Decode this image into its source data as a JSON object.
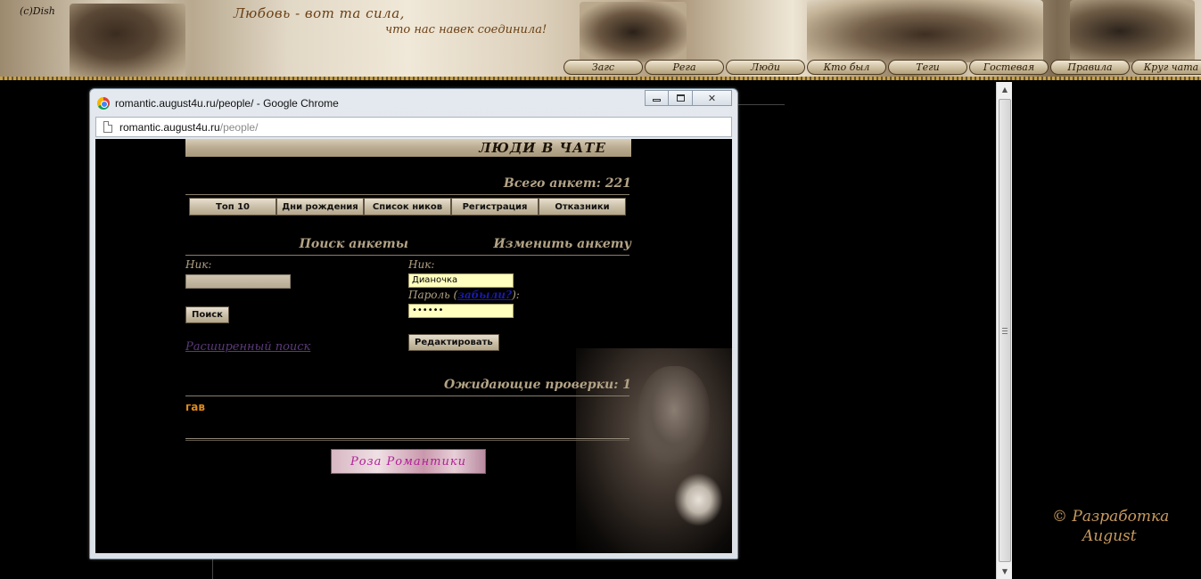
{
  "site": {
    "signature": "(c)Dish",
    "slogan_line1": "Любовь - вот та сила,",
    "slogan_line2": "что нас навек соединила!",
    "nav": [
      "Загс",
      "Рега",
      "Люди",
      "Кто был",
      "Теги",
      "Гостевая",
      "Правила",
      "Круг чата"
    ],
    "credit_line1": "©  Разработка",
    "credit_line2": "August"
  },
  "window": {
    "title": "romantic.august4u.ru/people/ - Google Chrome",
    "address_host": "romantic.august4u.ru",
    "address_path": "/people/",
    "close_glyph": "✕"
  },
  "page": {
    "title": "ЛЮДИ В ЧАТЕ",
    "total": "Всего анкет: 221",
    "tabs": [
      "Топ 10",
      "Дни рождения",
      "Список ников",
      "Регистрация",
      "Отказники"
    ],
    "search": {
      "heading": "Поиск анкеты",
      "nick_label": "Ник:",
      "nick_value": "",
      "button": "Поиск",
      "advanced_link": "Расширенный поиск"
    },
    "edit": {
      "heading": "Изменить анкету",
      "nick_label": "Ник:",
      "nick_value": "Дианочка",
      "password_label_prefix": "Пароль (",
      "forgot_link": "забыли?",
      "password_label_suffix": "):",
      "password_value": "••••••",
      "button": "Редактировать"
    },
    "pending_title": "Ожидающие проверки: 1",
    "pending_user": "гав",
    "banner_text": "Роза Романтики"
  },
  "colors": {
    "accent_text": "#b3a386",
    "link_orange": "#e08a1a",
    "input_filled": "#ffffc0"
  }
}
